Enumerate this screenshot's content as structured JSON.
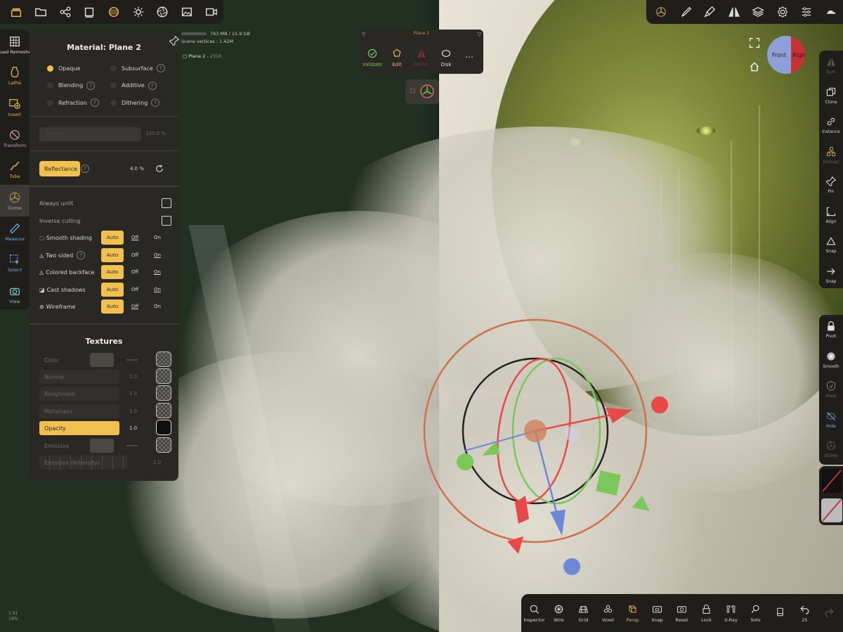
{
  "top_toolbar_left": {
    "icons": [
      "castle-icon",
      "folder-icon",
      "share-icon",
      "square-icon",
      "texture-icon",
      "sun-icon",
      "aperture-icon",
      "image-icon",
      "video-icon"
    ]
  },
  "top_toolbar_right": {
    "icons": [
      "gizmo-mode-icon",
      "brush-icon",
      "paint-icon",
      "symmetry-icon",
      "layers-icon",
      "settings-icon",
      "sliders-icon",
      "cloud-icon"
    ]
  },
  "tools": [
    {
      "label": "Quad Remesher",
      "icon": "grid-icon"
    },
    {
      "label": "Lathe",
      "icon": "vase-icon"
    },
    {
      "label": "Insert",
      "icon": "insert-icon"
    },
    {
      "label": "Transform",
      "icon": "transform-icon"
    },
    {
      "label": "Tube",
      "icon": "tube-icon"
    },
    {
      "label": "Gizmo",
      "icon": "gizmo-icon"
    },
    {
      "label": "Measure",
      "icon": "ruler-icon"
    },
    {
      "label": "Select",
      "icon": "select-icon"
    },
    {
      "label": "View",
      "icon": "camera-icon"
    }
  ],
  "material": {
    "title": "Material:  Plane 2",
    "modes": [
      {
        "label": "Opaque",
        "on": true
      },
      {
        "label": "Subsurface",
        "help": true
      },
      {
        "label": "Blending",
        "help": true
      },
      {
        "label": "Additive",
        "help": true
      },
      {
        "label": "Refraction",
        "help": true
      },
      {
        "label": "Dithering",
        "help": true
      }
    ],
    "slider_label": "Opacity",
    "slider_value": "100.0 %",
    "reflectance_label": "Reflectance",
    "reflectance_value": "4.0 %",
    "always_unlit": "Always unlit",
    "inverse_culling": "Inverse culling",
    "smooth_shading": "Smooth shading",
    "two_sided": "Two sided",
    "colored_backface": "Colored backface",
    "cast_shadows": "Cast shadows",
    "wireframe": "Wireframe",
    "opt_auto": "Auto",
    "opt_off": "Off",
    "opt_on": "On",
    "textures_title": "Textures",
    "tex": {
      "color": "Color",
      "normal": "Normal",
      "normal_val": "1.0",
      "roughness": "Roughness",
      "roughness_val": "1.0",
      "metalness": "Metalness",
      "metalness_val": "1.0",
      "opacity": "Opacity",
      "opacity_val": "1.0",
      "emissive": "Emissive",
      "emissive_intensity": "Emissive (Intensity)",
      "emissive_intensity_val": "1.0"
    }
  },
  "stats": {
    "memory": "763 MB / 15.9 GB",
    "vertices": "Scene vertices : 1.42M",
    "object": "Plane 2",
    "object_count": "2310",
    "object_suffix": "-"
  },
  "validate_panel": {
    "header": "Plane 2",
    "buttons": [
      "Validate",
      "Edit",
      "Mirror",
      "Disk"
    ],
    "more": "…"
  },
  "view_cube": {
    "front": "Front",
    "right": "Righ"
  },
  "right_column_1": [
    "Sym",
    "Clone",
    "Instance",
    "(Group)",
    "Pin",
    "Align",
    "Snap",
    "Snap"
  ],
  "right_column_2": [
    "Pivot",
    "Smooth",
    "Mask",
    "Hide",
    "Gizmo"
  ],
  "bottom_toolbar": [
    "Inspector",
    "Wire",
    "Grid",
    "Voxel",
    "Persp",
    "Snap",
    "Reset",
    "Lock",
    "X-Ray",
    "Solo",
    "",
    "25",
    ""
  ],
  "fps": {
    "line1": "1.91",
    "line2": "19%"
  },
  "colors": {
    "accent": "#f2c04f",
    "panel": "#2a2824",
    "toolbar": "#1f1e1b",
    "gizmo_x": "#e84848",
    "gizmo_y": "#7bc85a",
    "gizmo_z": "#6e88d8",
    "gizmo_ring": "#d0704a"
  }
}
